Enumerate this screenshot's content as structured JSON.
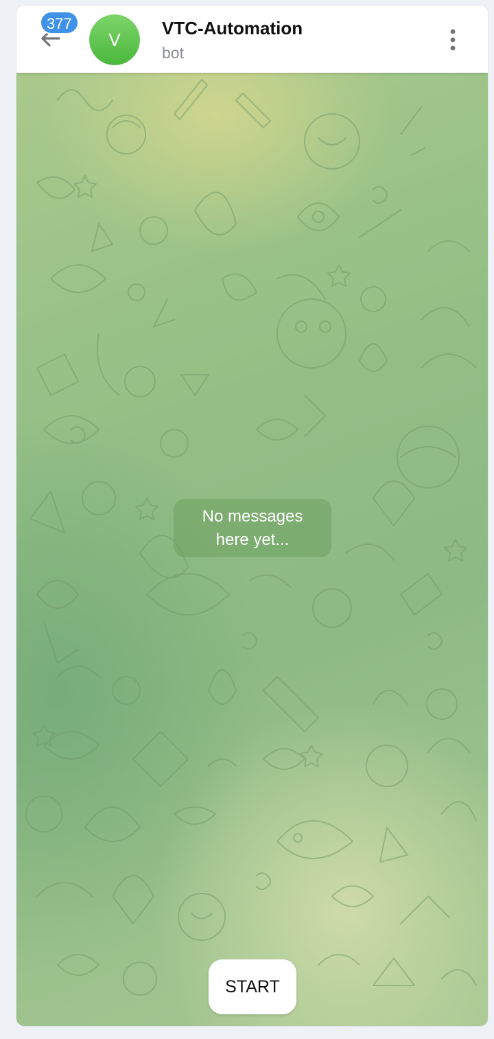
{
  "header": {
    "back_icon": "arrow-left-icon",
    "unread_count": "377",
    "avatar_letter": "V",
    "title": "VTC-Automation",
    "subtitle": "bot",
    "menu_icon": "more-vertical-icon"
  },
  "chat": {
    "empty_message": "No messages here yet...",
    "start_label": "START"
  },
  "colors": {
    "badge": "#3f92e8",
    "avatar": "#5cc24b",
    "chat_background": "#93bf86"
  }
}
